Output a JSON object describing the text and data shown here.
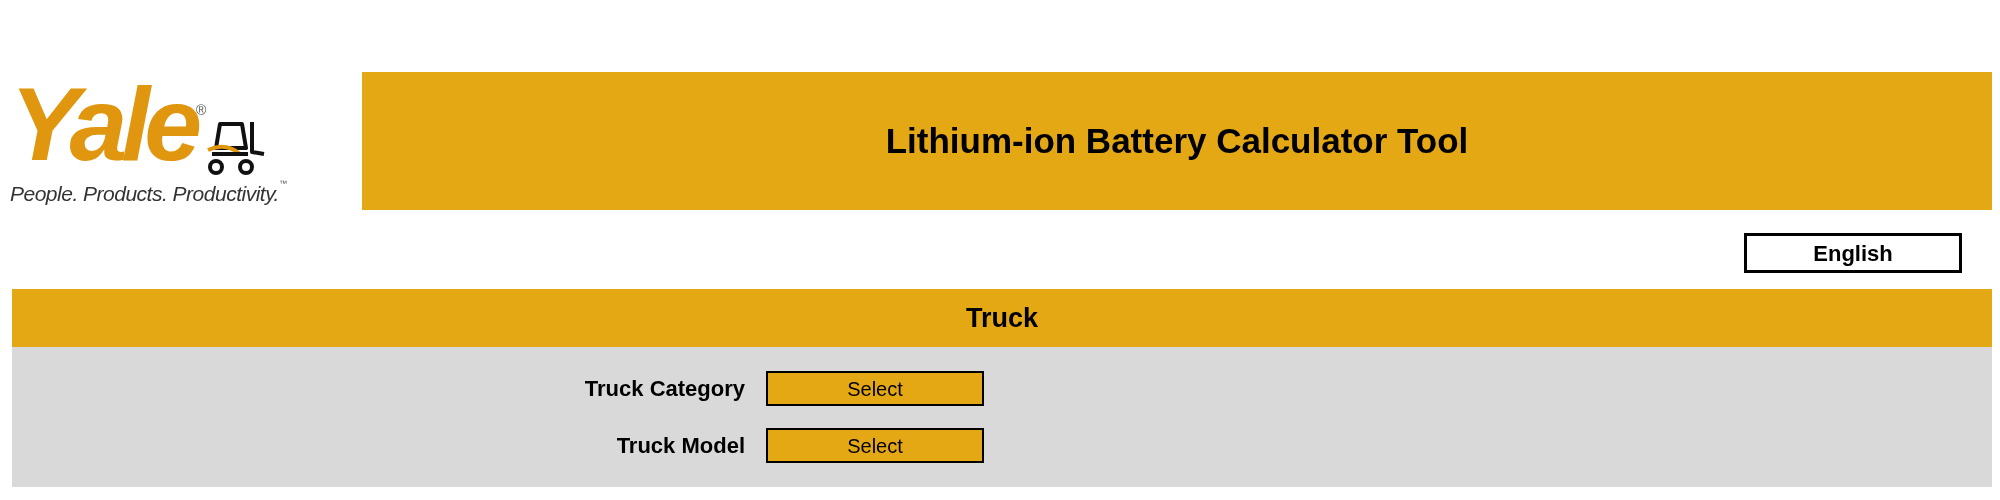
{
  "logo": {
    "wordmark": "Yale",
    "registered": "®",
    "tagline": "People. Products. Productivity.",
    "trademark": "™"
  },
  "header": {
    "title": "Lithium-ion Battery Calculator Tool"
  },
  "language_button": "English",
  "section": {
    "title": "Truck",
    "fields": [
      {
        "label": "Truck Category",
        "value": "Select"
      },
      {
        "label": "Truck Model",
        "value": "Select"
      }
    ]
  }
}
